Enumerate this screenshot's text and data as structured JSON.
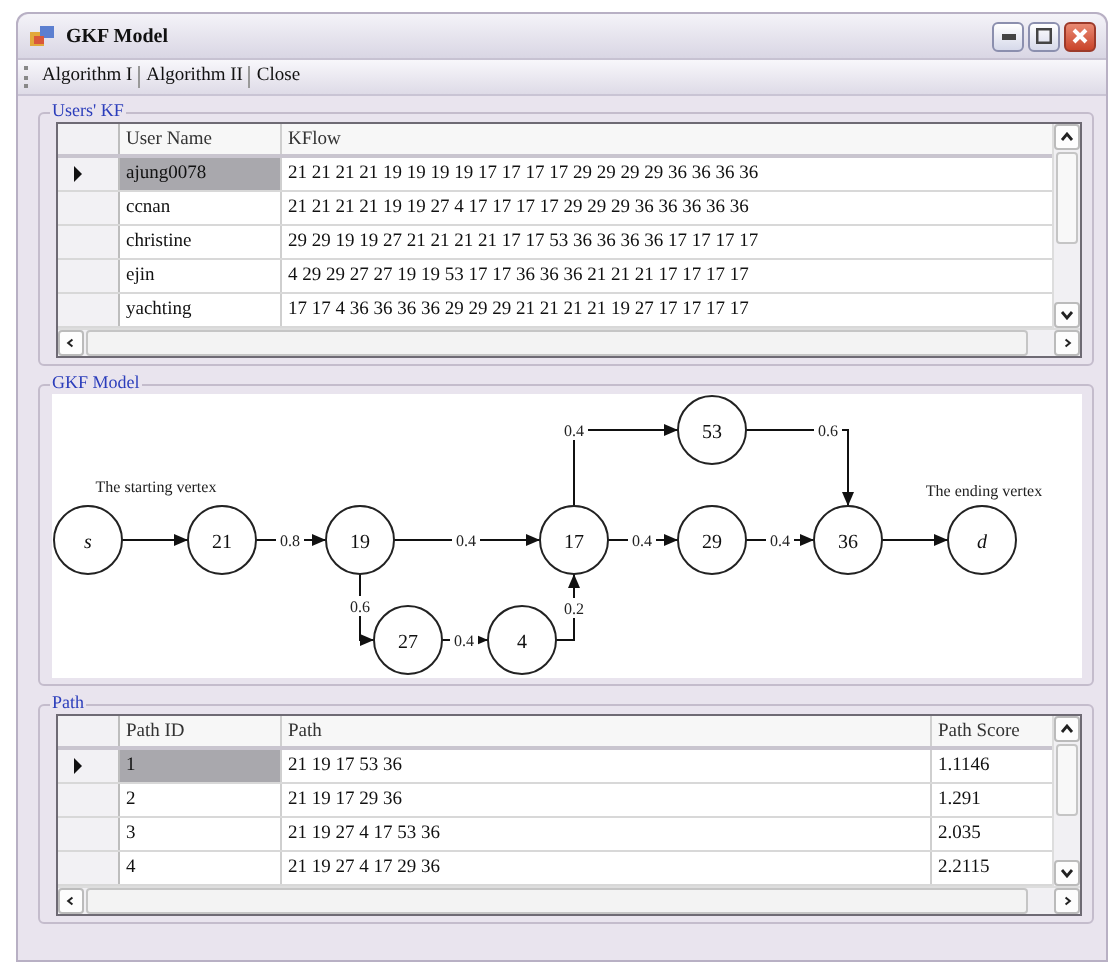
{
  "window": {
    "title": "GKF Model"
  },
  "menu": [
    {
      "label": "Algorithm I"
    },
    {
      "label": "Algorithm II"
    },
    {
      "label": "Close"
    }
  ],
  "users_kf": {
    "title": "Users' KF",
    "columns": [
      "User Name",
      "KFlow"
    ],
    "rows": [
      {
        "selected": true,
        "cells": [
          "ajung0078",
          "21 21 21 21 19 19 19 19 17 17 17 17 29 29 29 29 36 36 36 36"
        ]
      },
      {
        "selected": false,
        "cells": [
          "ccnan",
          "21 21 21 21 19 19 27 4 17 17 17 17 29 29 29 36 36 36 36 36"
        ]
      },
      {
        "selected": false,
        "cells": [
          "christine",
          "29 29 19 19 27 21 21 21 21 17 17 53 36 36 36 36 17 17 17 17"
        ]
      },
      {
        "selected": false,
        "cells": [
          "ejin",
          "4 29 29 27 27 19 19 53 17 17 36 36 36 21 21 21 17 17 17 17"
        ]
      },
      {
        "selected": false,
        "cells": [
          "yachting",
          "17 17 4 36 36 36 36 29 29 29 21 21 21 21 19 27 17 17 17 17"
        ]
      }
    ]
  },
  "gkf_model": {
    "title": "GKF Model",
    "start_caption": "The starting vertex",
    "end_caption": "The ending vertex",
    "nodes": [
      {
        "label": "s",
        "kind": "terminal"
      },
      {
        "label": "21",
        "kind": "vertex"
      },
      {
        "label": "19",
        "kind": "vertex"
      },
      {
        "label": "17",
        "kind": "vertex"
      },
      {
        "label": "29",
        "kind": "vertex"
      },
      {
        "label": "36",
        "kind": "vertex"
      },
      {
        "label": "d",
        "kind": "terminal"
      },
      {
        "label": "53",
        "kind": "vertex"
      },
      {
        "label": "27",
        "kind": "vertex"
      },
      {
        "label": "4",
        "kind": "vertex"
      }
    ],
    "edges": [
      {
        "kind": "plain"
      },
      {
        "kind": "weighted",
        "weight": "0.8"
      },
      {
        "kind": "weighted",
        "weight": "0.4"
      },
      {
        "kind": "weighted",
        "weight": "0.4"
      },
      {
        "kind": "weighted",
        "weight": "0.4"
      },
      {
        "kind": "plain"
      },
      {
        "kind": "weighted",
        "weight": "0.4"
      },
      {
        "kind": "weighted",
        "weight": "0.6"
      },
      {
        "kind": "weighted",
        "weight": "0.6"
      },
      {
        "kind": "weighted",
        "weight": "0.4"
      },
      {
        "kind": "weighted",
        "weight": "0.2"
      }
    ]
  },
  "path": {
    "title": "Path",
    "columns": [
      "Path ID",
      "Path",
      "Path Score"
    ],
    "rows": [
      {
        "selected": true,
        "cells": [
          "1",
          "21 19 17 53 36",
          "1.1146"
        ]
      },
      {
        "selected": false,
        "cells": [
          "2",
          "21 19 17 29 36",
          "1.291"
        ]
      },
      {
        "selected": false,
        "cells": [
          "3",
          "21 19 27 4 17 53 36",
          "2.035"
        ]
      },
      {
        "selected": false,
        "cells": [
          "4",
          "21 19 27 4 17 29 36",
          "2.2115"
        ]
      }
    ]
  }
}
